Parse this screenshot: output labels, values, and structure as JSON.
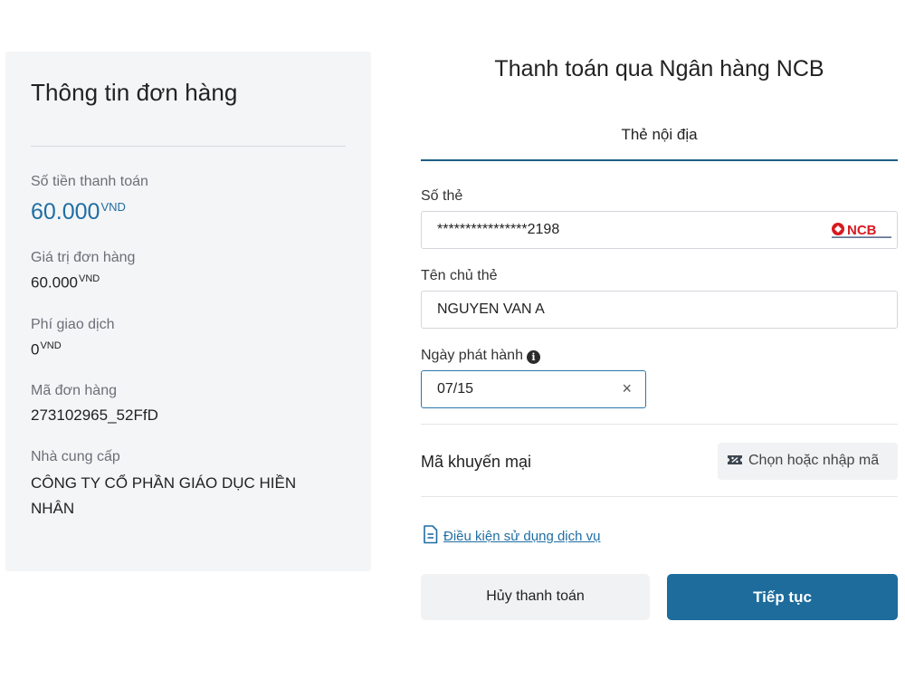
{
  "order": {
    "title": "Thông tin đơn hàng",
    "total_label": "Số tiền thanh toán",
    "total_value": "60.000",
    "currency": "VND",
    "order_value_label": "Giá trị đơn hàng",
    "order_value": "60.000",
    "fee_label": "Phí giao dịch",
    "fee_value": "0",
    "order_id_label": "Mã đơn hàng",
    "order_id": "273102965_52FfD",
    "provider_label": "Nhà cung cấp",
    "provider_name": "CÔNG TY CỔ PHẦN GIÁO DỤC HIỀN NHÂN"
  },
  "payment": {
    "title": "Thanh toán qua Ngân hàng NCB",
    "tab_label": "Thẻ nội địa",
    "card_number_label": "Số thẻ",
    "card_number_value": "****************2198",
    "card_holder_label": "Tên chủ thẻ",
    "card_holder_value": "NGUYEN VAN A",
    "issue_date_label": "Ngày phát hành",
    "issue_date_value": "07/15",
    "clear_symbol": "×",
    "info_symbol": "i",
    "bank_logo_text": "NCB",
    "promo_label": "Mã khuyến mại",
    "promo_button_label": "Chọn hoặc nhập mã",
    "terms_link": "Điều kiện sử dụng dịch vụ",
    "cancel_label": "Hủy thanh toán",
    "continue_label": "Tiếp tục"
  },
  "colors": {
    "accent": "#1f6ea3",
    "primary_button": "#1d6c9c",
    "panel_bg": "#f4f5f7",
    "ncb_red": "#d71920"
  }
}
